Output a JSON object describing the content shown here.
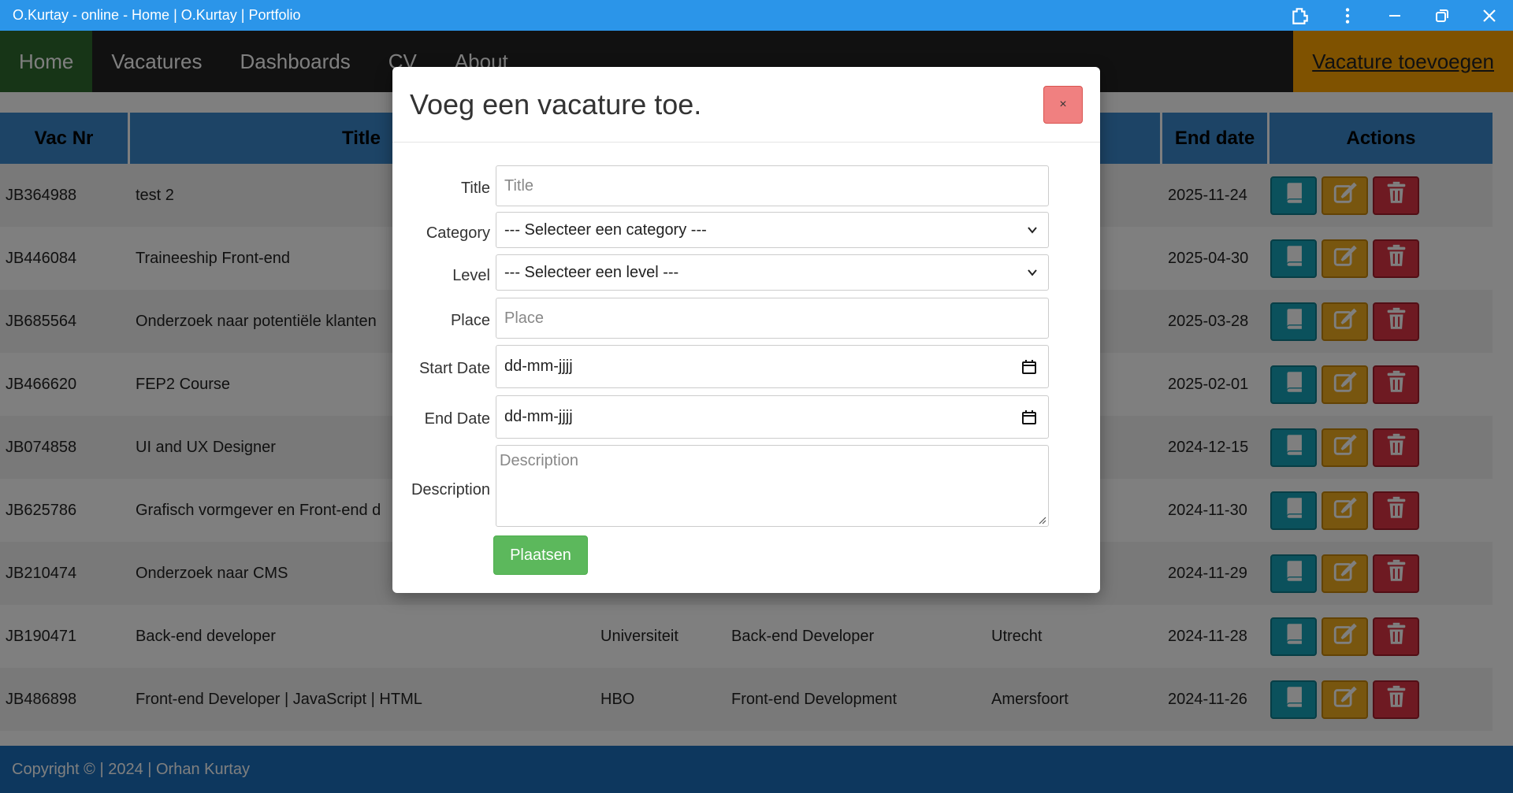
{
  "window": {
    "title": "O.Kurtay - online - Home | O.Kurtay | Portfolio"
  },
  "nav": {
    "items": [
      {
        "label": "Home"
      },
      {
        "label": "Vacatures"
      },
      {
        "label": "Dashboards"
      },
      {
        "label": "CV"
      },
      {
        "label": "About"
      }
    ],
    "cta_label": "Vacature toevoegen"
  },
  "table": {
    "headers": [
      "Vac Nr",
      "Title",
      "",
      "",
      "",
      "End date",
      "Actions"
    ],
    "rows": [
      {
        "vac_nr": "JB364988",
        "title": "test 2",
        "level": "",
        "category": "",
        "place": "",
        "end_date": "2025-11-24"
      },
      {
        "vac_nr": "JB446084",
        "title": "Traineeship Front-end",
        "level": "",
        "category": "",
        "place": "",
        "end_date": "2025-04-30"
      },
      {
        "vac_nr": "JB685564",
        "title": "Onderzoek naar potentiële klanten",
        "level": "",
        "category": "",
        "place": "",
        "end_date": "2025-03-28"
      },
      {
        "vac_nr": "JB466620",
        "title": "FEP2 Course",
        "level": "",
        "category": "",
        "place": "",
        "end_date": "2025-02-01"
      },
      {
        "vac_nr": "JB074858",
        "title": "UI and UX Designer",
        "level": "",
        "category": "",
        "place": "",
        "end_date": "2024-12-15"
      },
      {
        "vac_nr": "JB625786",
        "title": "Grafisch vormgever en Front-end d",
        "level": "",
        "category": "",
        "place": "",
        "end_date": "2024-11-30"
      },
      {
        "vac_nr": "JB210474",
        "title": "Onderzoek naar CMS",
        "level": "",
        "category": "",
        "place": "",
        "end_date": "2024-11-29"
      },
      {
        "vac_nr": "JB190471",
        "title": "Back-end developer",
        "level": "Universiteit",
        "category": "Back-end Developer",
        "place": "Utrecht",
        "end_date": "2024-11-28"
      },
      {
        "vac_nr": "JB486898",
        "title": "Front-end Developer | JavaScript | HTML",
        "level": "HBO",
        "category": "Front-end Development",
        "place": "Amersfoort",
        "end_date": "2024-11-26"
      }
    ]
  },
  "footer": {
    "text": "Copyright © | 2024 | Orhan Kurtay"
  },
  "modal": {
    "title": "Voeg een vacature toe.",
    "close_label": "×",
    "fields": {
      "title": {
        "label": "Title",
        "placeholder": "Title"
      },
      "category": {
        "label": "Category",
        "value": "--- Selecteer een category ---"
      },
      "level": {
        "label": "Level",
        "value": "--- Selecteer een level ---"
      },
      "place": {
        "label": "Place",
        "placeholder": "Place"
      },
      "start_date": {
        "label": "Start Date",
        "value": "dd-mm-jjjj"
      },
      "end_date": {
        "label": "End Date",
        "value": "dd-mm-jjjj"
      },
      "description": {
        "label": "Description",
        "placeholder": "Description"
      }
    },
    "submit_label": "Plaatsen"
  },
  "colors": {
    "titlebar": "#2b95e9",
    "nav_bg": "#222222",
    "nav_active": "#2f6b2f",
    "cta": "#ffa500",
    "table_header": "#3b88cc",
    "footer": "#1a6fbd",
    "view_btn": "#17a2b8",
    "edit_btn": "#f0ad1e",
    "delete_btn": "#dc3545",
    "submit_btn": "#5cb85c",
    "close_btn": "#f08080"
  },
  "icons": {
    "view": "book-icon",
    "edit": "edit-icon",
    "delete": "trash-icon"
  }
}
